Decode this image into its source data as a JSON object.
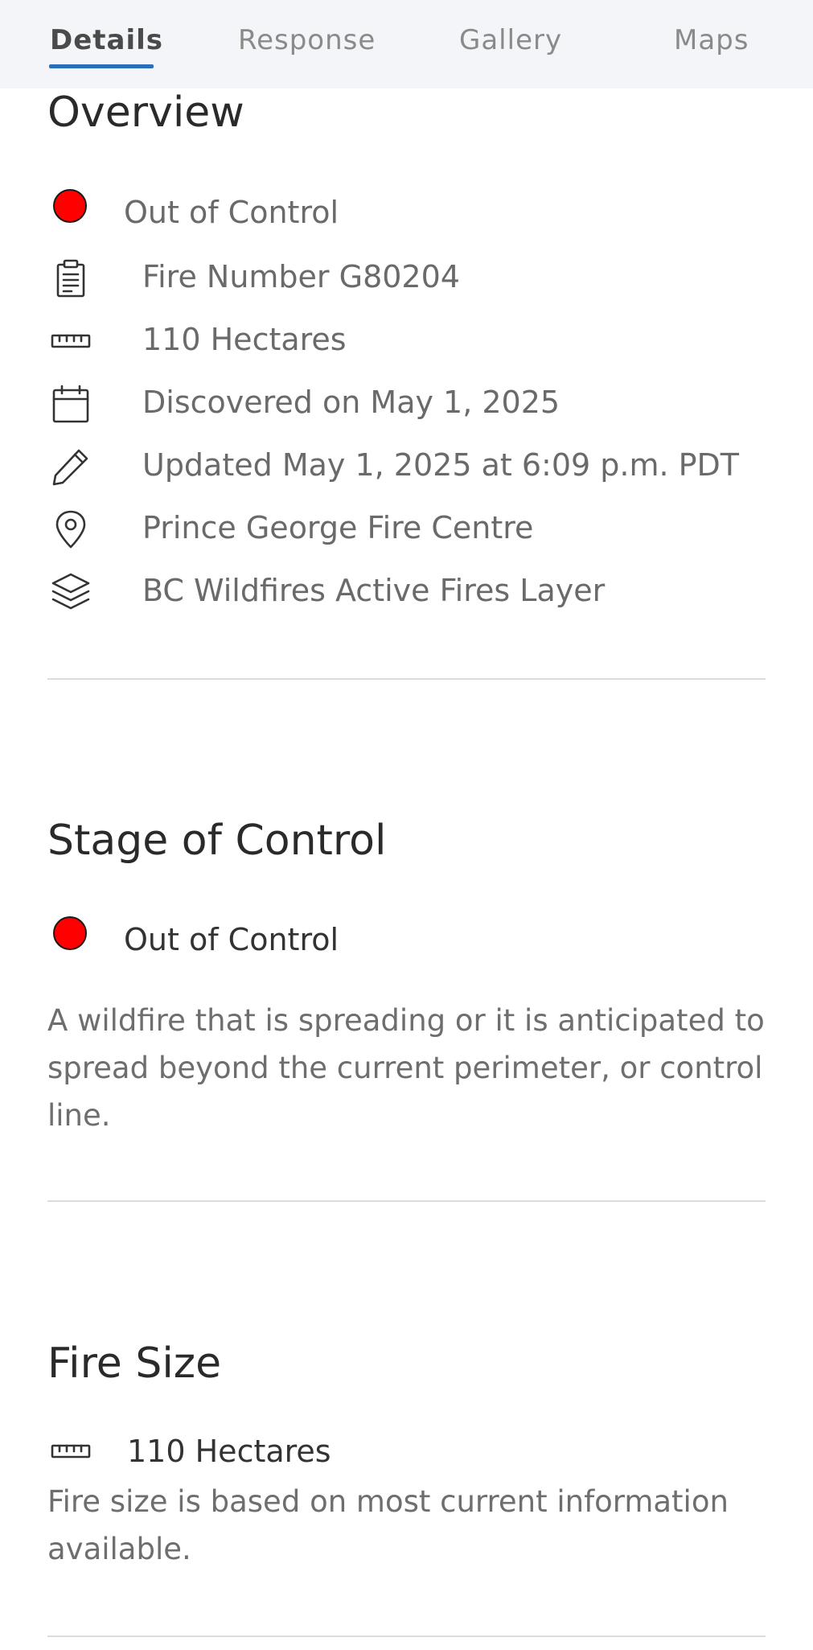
{
  "tabs": [
    {
      "label": "Details",
      "active": true
    },
    {
      "label": "Response",
      "active": false
    },
    {
      "label": "Gallery",
      "active": false
    },
    {
      "label": "Maps",
      "active": false
    }
  ],
  "overview": {
    "title": "Overview",
    "status": {
      "text": "Out of Control",
      "color": "#ff0000"
    },
    "items": [
      {
        "icon": "clipboard-icon",
        "text": "Fire Number G80204"
      },
      {
        "icon": "ruler-icon",
        "text": "110 Hectares"
      },
      {
        "icon": "calendar-icon",
        "text": "Discovered on May 1, 2025"
      },
      {
        "icon": "pencil-icon",
        "text": "Updated May 1, 2025 at 6:09 p.m. PDT"
      },
      {
        "icon": "location-pin-icon",
        "text": "Prince George Fire Centre"
      },
      {
        "icon": "layers-icon",
        "text": "BC Wildfires Active Fires Layer"
      }
    ]
  },
  "stage_of_control": {
    "title": "Stage of Control",
    "status": {
      "text": "Out of Control",
      "color": "#ff0000"
    },
    "description": "A wildfire that is spreading or it is anticipated to spread beyond the current perimeter, or control line."
  },
  "fire_size": {
    "title": "Fire Size",
    "icon": "ruler-icon",
    "value": "110 Hectares",
    "description": "Fire size is based on most current information available."
  },
  "colors": {
    "accent": "#2a6ebb",
    "status_out_of_control": "#ff0000",
    "tab_background": "#f3f5f8"
  }
}
